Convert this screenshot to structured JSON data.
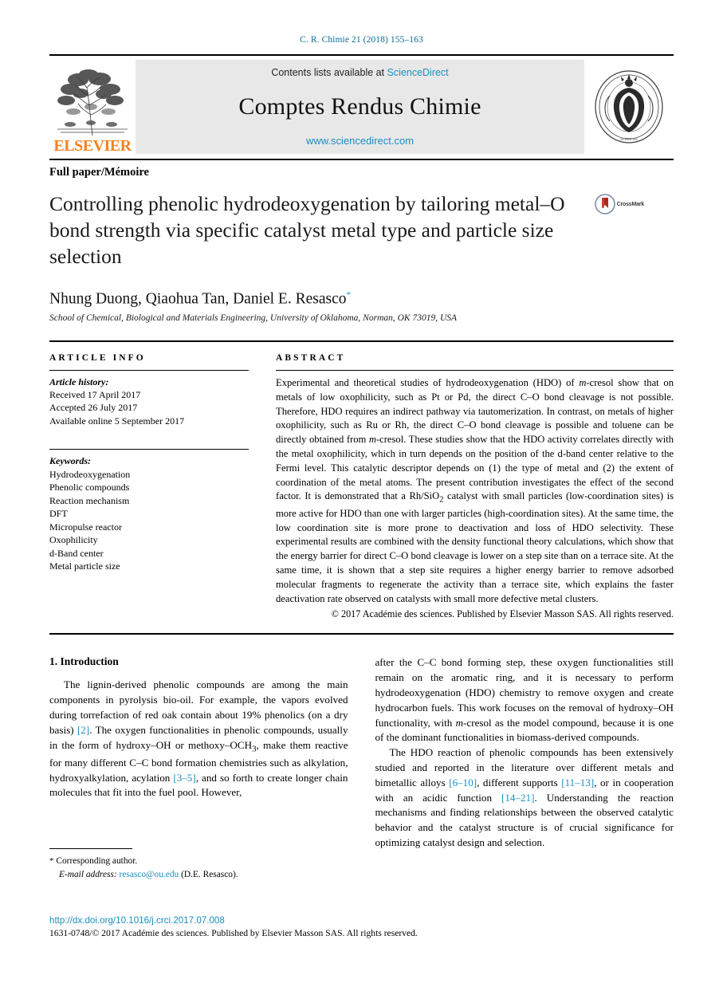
{
  "running_head": "C. R. Chimie 21 (2018) 155–163",
  "masthead": {
    "publisher_logo_text": "ELSEVIER",
    "contents_prefix": "Contents lists available at ",
    "contents_link": "ScienceDirect",
    "journal_name": "Comptes Rendus Chimie",
    "journal_url": "www.sciencedirect.com",
    "seal_text_outer": "INSTITUT DE FRANCE · ACADÉMIE DES SCIENCES"
  },
  "article_type": "Full paper/Mémoire",
  "title": "Controlling phenolic hydrodeoxygenation by tailoring metal–O bond strength via specific catalyst metal type and particle size selection",
  "crossmark_label": "CrossMark",
  "authors": "Nhung Duong, Qiaohua Tan, Daniel E. Resasco",
  "corresponding_marker": "*",
  "affiliation": "School of Chemical, Biological and Materials Engineering, University of Oklahoma, Norman, OK 73019, USA",
  "article_info": {
    "heading": "ARTICLE INFO",
    "history_label": "Article history:",
    "history": [
      "Received 17 April 2017",
      "Accepted 26 July 2017",
      "Available online 5 September 2017"
    ],
    "keywords_label": "Keywords:",
    "keywords": [
      "Hydrodeoxygenation",
      "Phenolic compounds",
      "Reaction mechanism",
      "DFT",
      "Micropulse reactor",
      "Oxophilicity",
      "d-Band center",
      "Metal particle size"
    ]
  },
  "abstract": {
    "heading": "ABSTRACT",
    "text": "Experimental and theoretical studies of hydrodeoxygenation (HDO) of m-cresol show that on metals of low oxophilicity, such as Pt or Pd, the direct C–O bond cleavage is not possible. Therefore, HDO requires an indirect pathway via tautomerization. In contrast, on metals of higher oxophilicity, such as Ru or Rh, the direct C–O bond cleavage is possible and toluene can be directly obtained from m-cresol. These studies show that the HDO activity correlates directly with the metal oxophilicity, which in turn depends on the position of the d-band center relative to the Fermi level. This catalytic descriptor depends on (1) the type of metal and (2) the extent of coordination of the metal atoms. The present contribution investigates the effect of the second factor. It is demonstrated that a Rh/SiO2 catalyst with small particles (low-coordination sites) is more active for HDO than one with larger particles (high-coordination sites). At the same time, the low coordination site is more prone to deactivation and loss of HDO selectivity. These experimental results are combined with the density functional theory calculations, which show that the energy barrier for direct C–O bond cleavage is lower on a step site than on a terrace site. At the same time, it is shown that a step site requires a higher energy barrier to remove adsorbed molecular fragments to regenerate the activity than a terrace site, which explains the faster deactivation rate observed on catalysts with small more defective metal clusters.",
    "copyright": "© 2017 Académie des sciences. Published by Elsevier Masson SAS. All rights reserved."
  },
  "body": {
    "section_number_title": "1. Introduction",
    "left_paragraph_1": "The lignin-derived phenolic compounds are among the main components in pyrolysis bio-oil. For example, the vapors evolved during torrefaction of red oak contain about 19% phenolics (on a dry basis) [2]. The oxygen functionalities in phenolic compounds, usually in the form of hydroxy–OH or methoxy–OCH3, make them reactive for many different C–C bond formation chemistries such as alkylation, hydroxyalkylation, acylation [3–5], and so forth to create longer chain molecules that fit into the fuel pool. However,",
    "right_paragraph_1": "after the C–C bond forming step, these oxygen functionalities still remain on the aromatic ring, and it is necessary to perform hydrodeoxygenation (HDO) chemistry to remove oxygen and create hydrocarbon fuels. This work focuses on the removal of hydroxy–OH functionality, with m-cresol as the model compound, because it is one of the dominant functionalities in biomass-derived compounds.",
    "right_paragraph_2": "The HDO reaction of phenolic compounds has been extensively studied and reported in the literature over different metals and bimetallic alloys [6–10], different supports [11–13], or in cooperation with an acidic function [14–21]. Understanding the reaction mechanisms and finding relationships between the observed catalytic behavior and the catalyst structure is of crucial significance for optimizing catalyst design and selection.",
    "refs": [
      "[2]",
      "[3–5]",
      "[6–10]",
      "[11–13]",
      "[14–21]"
    ]
  },
  "footnote": {
    "marker": "*",
    "corresponding": "Corresponding author.",
    "email_label": "E-mail address:",
    "email": "resasco@ou.edu",
    "email_suffix": "(D.E. Resasco)."
  },
  "bottom": {
    "doi": "http://dx.doi.org/10.1016/j.crci.2017.07.008",
    "issn_line": "1631-0748/© 2017 Académie des sciences. Published by Elsevier Masson SAS. All rights reserved."
  },
  "colors": {
    "link": "#1a8fc1",
    "elsevier_orange": "#f58220",
    "masthead_bg": "#e8e8e8"
  }
}
